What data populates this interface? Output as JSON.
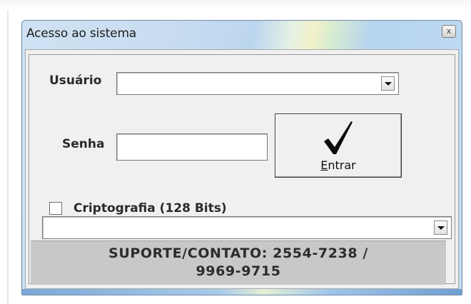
{
  "window": {
    "title": "Acesso ao sistema",
    "close_symbol": "x",
    "accent_frame_color": "#bcd6ef"
  },
  "form": {
    "usuario": {
      "label": "Usuário",
      "value": ""
    },
    "senha": {
      "label": "Senha",
      "value": ""
    },
    "entrar_button": {
      "accesskey_letter": "E",
      "label_rest": "ntrar",
      "icon": "checkmark-icon"
    },
    "criptografia": {
      "label": "Criptografia (128 Bits)",
      "checked": false
    },
    "server_select": {
      "value": ""
    }
  },
  "support": {
    "line1": "SUPORTE/CONTATO: 2554-7238 /",
    "line2": "9969-9715"
  }
}
